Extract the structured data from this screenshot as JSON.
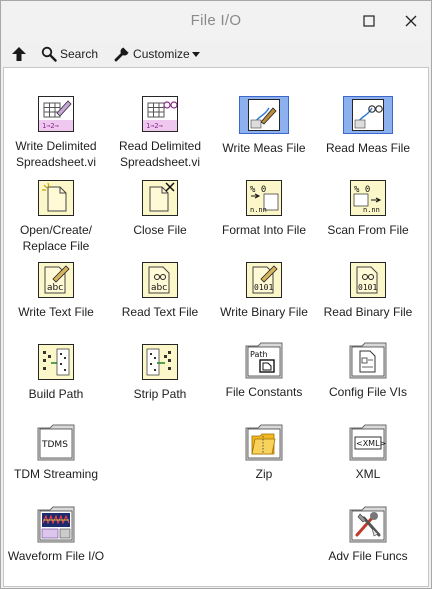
{
  "window": {
    "title": "File I/O"
  },
  "toolbar": {
    "search_label": "Search",
    "customize_label": "Customize"
  },
  "items": [
    {
      "label": "Write Delimited\nSpreadsheet.vi",
      "icon": "write-spreadsheet-icon"
    },
    {
      "label": "Read Delimited\nSpreadsheet.vi",
      "icon": "read-spreadsheet-icon"
    },
    {
      "label": "Write Meas File",
      "icon": "write-meas-file-icon"
    },
    {
      "label": "Read Meas File",
      "icon": "read-meas-file-icon"
    },
    {
      "label": "Open/Create/\nReplace File",
      "icon": "open-file-icon"
    },
    {
      "label": "Close File",
      "icon": "close-file-icon"
    },
    {
      "label": "Format Into File",
      "icon": "format-into-file-icon"
    },
    {
      "label": "Scan From File",
      "icon": "scan-from-file-icon"
    },
    {
      "label": "Write Text File",
      "icon": "write-text-file-icon"
    },
    {
      "label": "Read Text File",
      "icon": "read-text-file-icon"
    },
    {
      "label": "Write Binary File",
      "icon": "write-binary-file-icon"
    },
    {
      "label": "Read Binary File",
      "icon": "read-binary-file-icon"
    },
    {
      "label": "Build Path",
      "icon": "build-path-icon"
    },
    {
      "label": "Strip Path",
      "icon": "strip-path-icon"
    },
    {
      "label": "File Constants",
      "icon": "file-constants-folder-icon",
      "icon_text": "Path"
    },
    {
      "label": "Config File VIs",
      "icon": "config-file-folder-icon"
    },
    {
      "label": "TDM Streaming",
      "icon": "tdm-streaming-folder-icon",
      "icon_text": "TDMS"
    },
    {
      "label": "Zip",
      "icon": "zip-folder-icon"
    },
    {
      "label": "XML",
      "icon": "xml-folder-icon",
      "icon_text": "<XML>"
    },
    {
      "label": "Waveform File I/O",
      "icon": "waveform-file-folder-icon"
    },
    {
      "label": "Adv File Funcs",
      "icon": "adv-file-funcs-folder-icon"
    }
  ],
  "icon_glyphs": {
    "grid_text": "1⇒2⇒",
    "format_text": "% 0",
    "binary_text": "0101",
    "nnn": "n.nn",
    "abc": "abc"
  }
}
